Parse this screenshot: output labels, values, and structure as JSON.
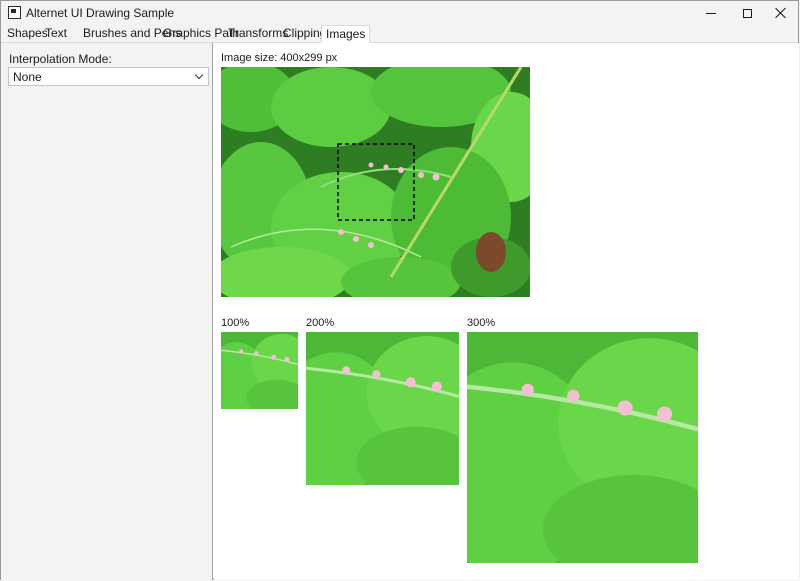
{
  "window": {
    "title": "Alternet UI Drawing Sample",
    "controls": [
      "minimize",
      "maximize",
      "close"
    ]
  },
  "tabs": [
    {
      "label": "Shapes",
      "active": false
    },
    {
      "label": "Text",
      "active": false
    },
    {
      "label": "Brushes and Pens",
      "active": false
    },
    {
      "label": "Graphics Path",
      "active": false
    },
    {
      "label": "Transforms",
      "active": false
    },
    {
      "label": "Clipping",
      "active": false
    },
    {
      "label": "Images",
      "active": true
    }
  ],
  "sidebar": {
    "interpolation_label": "Interpolation Mode:",
    "interpolation_value": "None",
    "icon": "chevron-down-icon"
  },
  "main": {
    "image_size_label": "Image size: 400x299 px",
    "zoom_labels": [
      "100%",
      "200%",
      "300%"
    ]
  },
  "colors": {
    "leaf_light": "#6fd84a",
    "leaf_mid": "#49b836",
    "leaf_dark": "#2c7f20",
    "flower_pink": "#f2c0d0"
  }
}
